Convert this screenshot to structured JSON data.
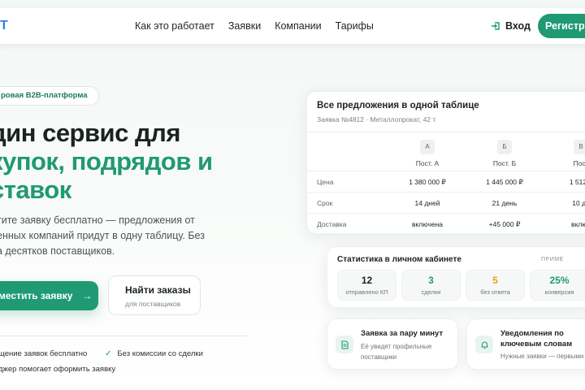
{
  "header": {
    "logo_fragment": "T",
    "nav": [
      "Как это работает",
      "Заявки",
      "Компании",
      "Тарифы"
    ],
    "login_label": "Вход",
    "register_label": "Регистра"
  },
  "hero": {
    "badge": "ровая B2B-платформа",
    "title_line1": "дин сервис для",
    "title_line2": "купок, подрядов и",
    "title_line3": "ставок",
    "sub_line1": "тите заявку бесплатно — предложения от",
    "sub_line2": "енных компаний придут в одну таблицу. Без",
    "sub_line3": "а десятков поставщиков.",
    "primary_button": "местить заявку",
    "secondary_button_title": "Найти заказы",
    "secondary_button_sub": "для поставщиков",
    "perks": [
      "щение заявок бесплатно",
      "Без комиссии со сделки",
      "джер помогает оформить заявку"
    ]
  },
  "offers": {
    "title": "Все предложения в одной таблице",
    "subtitle": "Заявка №4812 · Металлопрокат, 42 т",
    "columns": [
      {
        "chip": "А",
        "name": "Пост. А"
      },
      {
        "chip": "Б",
        "name": "Пост. Б"
      },
      {
        "chip": "В",
        "name": "Пост"
      }
    ],
    "rows": [
      {
        "label": "Цена",
        "values": [
          "1 380 000 ₽",
          "1 445 000 ₽",
          "1 512 0"
        ]
      },
      {
        "label": "Срок",
        "values": [
          "14 дней",
          "21 день",
          "10 дн"
        ]
      },
      {
        "label": "Доставка",
        "values": [
          "включена",
          "+45 000 ₽",
          "включ"
        ]
      }
    ]
  },
  "stats": {
    "title": "Статистика в личном кабинете",
    "tag": "ПРИМЕ",
    "items": [
      {
        "value": "12",
        "label": "отправлено КП",
        "color": "#1b2320"
      },
      {
        "value": "3",
        "label": "сделки",
        "color": "#1f9a73"
      },
      {
        "value": "5",
        "label": "без ответа",
        "color": "#e2a31a"
      },
      {
        "value": "25%",
        "label": "конверсия",
        "color": "#1f9a73"
      }
    ]
  },
  "features": [
    {
      "title": "Заявка за пару минут",
      "desc_line1": "Её увидят профильные",
      "desc_line2": "поставщики",
      "icon": "document-icon"
    },
    {
      "title_line1": "Уведомления по",
      "title_line2": "ключевым словам",
      "desc": "Нужные заявки — первыми",
      "icon": "bell-icon"
    }
  ]
}
